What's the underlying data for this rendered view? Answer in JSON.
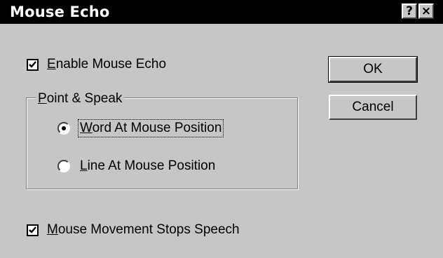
{
  "window": {
    "title": "Mouse Echo",
    "help_glyph": "?",
    "close_glyph": "×"
  },
  "options": {
    "enable_mouse_echo": {
      "label_first": "E",
      "label_rest": "nable Mouse Echo",
      "checked": true
    },
    "mouse_movement_stops_speech": {
      "label_first": "M",
      "label_rest": "ouse Movement Stops Speech",
      "checked": true
    }
  },
  "point_speak": {
    "legend_first": "P",
    "legend_rest": "oint & Speak",
    "items": [
      {
        "label_first": "W",
        "label_rest": "ord At Mouse Position",
        "selected": true,
        "focused": true
      },
      {
        "label_first": "L",
        "label_rest": "ine At Mouse Position",
        "selected": false,
        "focused": false
      }
    ]
  },
  "buttons": {
    "ok": "OK",
    "cancel": "Cancel"
  }
}
